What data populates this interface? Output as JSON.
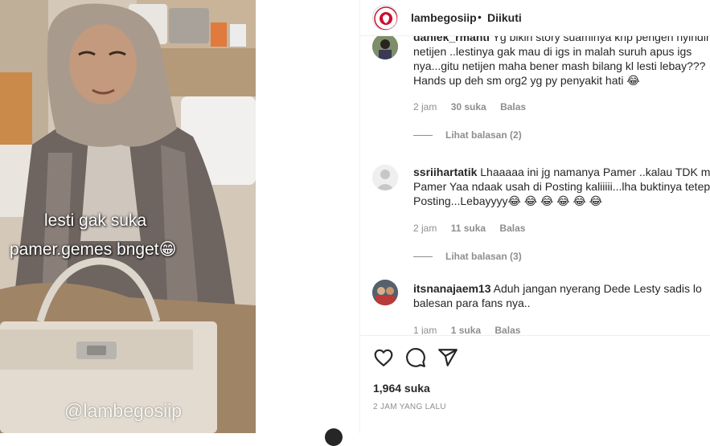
{
  "video": {
    "caption_line1": "lesti gak suka",
    "caption_line2": "pamer.gemes bnget😁",
    "watermark": "@lambegosiip"
  },
  "header": {
    "username": "lambegosiip",
    "separator": "•",
    "follow_status": "Diikuti"
  },
  "comments": [
    {
      "username": "daniek_rmanti",
      "lines": [
        "Yg bikin story suaminya knp pengen nyindir",
        "netijen ..lestinya gak mau di igs in malah suruh apus igs",
        "nya...gitu netijen maha bener mash bilang kl lesti lebay???",
        "Hands up deh sm org2 yg py penyakit hati 😂"
      ],
      "time": "2 jam",
      "likes": "30 suka",
      "reply": "Balas",
      "view_replies": "Lihat balasan (2)"
    },
    {
      "username": "ssriihartatik",
      "lines": [
        "Lhaaaaa ini jg namanya Pamer ..kalau TDK mau",
        "Pamer Yaa ndaak usah di Posting kaliiiii...lha buktinya tetep di",
        "Posting...Lebayyyy😂 😂 😂 😂 😂 😂"
      ],
      "time": "2 jam",
      "likes": "11 suka",
      "reply": "Balas",
      "view_replies": "Lihat balasan (3)"
    },
    {
      "username": "itsnanajaem13",
      "lines": [
        "Aduh jangan nyerang Dede Lesty sadis lo",
        "balesan para fans nya.."
      ],
      "time": "1 jam",
      "likes": "1 suka",
      "reply": "Balas"
    }
  ],
  "actions": {
    "like_icon": "heart-icon",
    "comment_icon": "comment-bubble-icon",
    "share_icon": "paper-plane-icon"
  },
  "likes_total": "1,964 suka",
  "post_time": "2 JAM YANG LALU"
}
